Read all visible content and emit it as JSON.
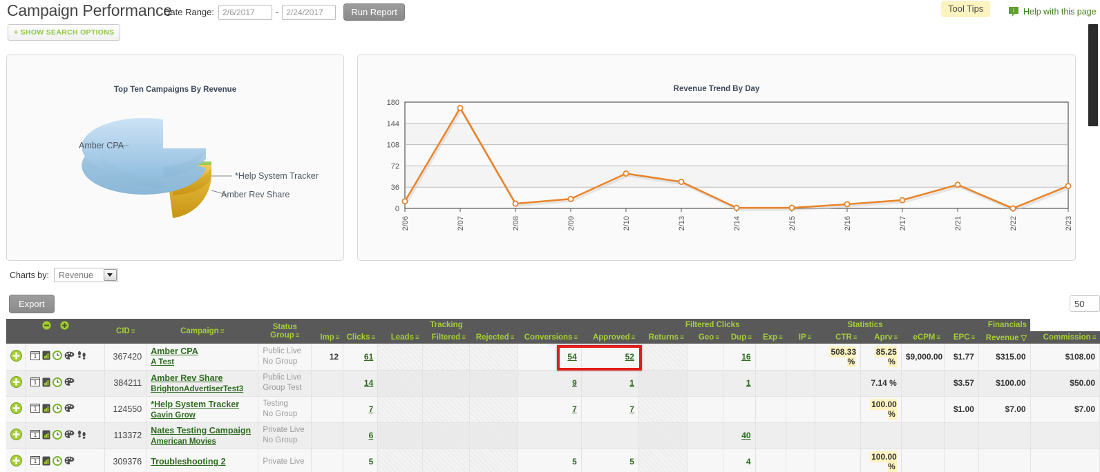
{
  "header": {
    "title": "Campaign Performance",
    "date_range_label": "Date Range:",
    "date_from": "2/6/2017",
    "date_to": "2/24/2017",
    "dash": "-",
    "run_report": "Run Report",
    "show_search_options": "+ SHOW SEARCH OPTIONS",
    "tool_tips": "Tool Tips",
    "help_text": "Help with this page"
  },
  "controls": {
    "charts_by_label": "Charts by:",
    "charts_by_value": "Revenue",
    "export_label": "Export",
    "rows_per_page": "50"
  },
  "colors": {
    "accent_green": "#a6ce39",
    "link_green": "#2d6a1e",
    "header_gray": "#595959",
    "line_orange": "#e8842a",
    "pie_blue": "#a8cbe8",
    "pie_gold": "#e8b93c",
    "highlight_yellow": "#fdf3c0",
    "redbox": "#e21b1b"
  },
  "chart_data": [
    {
      "type": "pie",
      "title": "Top Ten Campaigns By Revenue",
      "labels": [
        "Amber CPA",
        "*Help System Tracker",
        "Amber Rev Share"
      ],
      "values": [
        315.0,
        7.0,
        100.0
      ],
      "slice_colors": [
        "#a8cbe8",
        "#8dc63f",
        "#e8b93c"
      ],
      "legend": "callout-labels",
      "exploded": true
    },
    {
      "type": "line",
      "title": "Revenue Trend By Day",
      "xlabel": "",
      "ylabel": "",
      "categories": [
        "2/06",
        "2/07",
        "2/08",
        "2/09",
        "2/10",
        "2/13",
        "2/14",
        "2/15",
        "2/16",
        "2/17",
        "2/21",
        "2/22",
        "2/23"
      ],
      "values": [
        12,
        170,
        8,
        16,
        59,
        45,
        1,
        1,
        7,
        14,
        40,
        0,
        38
      ],
      "yticks": [
        0,
        36,
        72,
        108,
        144,
        180
      ],
      "ylim": [
        0,
        180
      ],
      "grid": true,
      "series_color": "#e8842a",
      "marker": "open-circle"
    }
  ],
  "table": {
    "group_headers": [
      {
        "label": "",
        "span": 5
      },
      {
        "label": "Tracking",
        "span": 6
      },
      {
        "label": "",
        "span": 1
      },
      {
        "label": "Filtered Clicks",
        "span": 4
      },
      {
        "label": "Statistics",
        "span": 4
      },
      {
        "label": "Financials",
        "span": 2
      }
    ],
    "columns": [
      {
        "label": "",
        "key": "expand"
      },
      {
        "label": "",
        "key": "icons"
      },
      {
        "label": "CID",
        "key": "cid",
        "sortable": true
      },
      {
        "label": "Campaign",
        "key": "campaign",
        "sortable": true
      },
      {
        "label": "Status Group",
        "key": "status_group",
        "sortable": true
      },
      {
        "label": "Imp",
        "key": "imp",
        "sortable": true
      },
      {
        "label": "Clicks",
        "key": "clicks",
        "sortable": true
      },
      {
        "label": "Leads",
        "key": "leads",
        "sortable": true
      },
      {
        "label": "Filtered",
        "key": "filtered",
        "sortable": true
      },
      {
        "label": "Rejected",
        "key": "rejected",
        "sortable": true
      },
      {
        "label": "Conversions",
        "key": "conversions",
        "sortable": true
      },
      {
        "label": "Approved",
        "key": "approved",
        "sortable": true
      },
      {
        "label": "Returns",
        "key": "returns",
        "sortable": true
      },
      {
        "label": "Geo",
        "key": "geo",
        "sortable": true
      },
      {
        "label": "Dup",
        "key": "dup",
        "sortable": true
      },
      {
        "label": "Exp",
        "key": "exp",
        "sortable": true
      },
      {
        "label": "IP",
        "key": "ip",
        "sortable": true
      },
      {
        "label": "CTR",
        "key": "ctr",
        "sortable": true
      },
      {
        "label": "Aprv",
        "key": "aprv",
        "sortable": true
      },
      {
        "label": "eCPM",
        "key": "ecpm",
        "sortable": true
      },
      {
        "label": "EPC",
        "key": "epc",
        "sortable": true
      },
      {
        "label": "Revenue",
        "key": "revenue",
        "sorted_desc": true
      },
      {
        "label": "Commission",
        "key": "commission",
        "sortable": true
      }
    ],
    "rows": [
      {
        "icons": [
          "calendar-icon",
          "mobile-chart-icon",
          "clock-icon",
          "palette-icon",
          "footsteps-icon"
        ],
        "cid": "367420",
        "campaign": "Amber CPA",
        "advertiser": "A Test",
        "status": "Public Live",
        "group": "No Group",
        "imp": "12",
        "clicks": "61",
        "leads": "",
        "filtered": "",
        "rejected": "",
        "conversions": "54",
        "approved": "52",
        "returns": "",
        "geo": "",
        "dup": "16",
        "exp": "",
        "ip": "",
        "ctr": "508.33 %",
        "ctr_hl": true,
        "aprv": "85.25 %",
        "aprv_hl": true,
        "ecpm": "$9,000.00",
        "epc": "$1.77",
        "revenue": "$315.00",
        "commission": "$108.00"
      },
      {
        "icons": [
          "calendar-icon",
          "mobile-chart-icon",
          "clock-icon",
          "palette-icon"
        ],
        "cid": "384211",
        "campaign": "Amber Rev Share",
        "advertiser": "BrightonAdvertiserTest3",
        "status": "Public Live",
        "group": "Group Test",
        "imp": "",
        "clicks": "14",
        "leads": "",
        "filtered": "",
        "rejected": "",
        "conversions": "9",
        "approved": "1",
        "returns": "",
        "geo": "",
        "dup": "1",
        "exp": "",
        "ip": "",
        "ctr": "",
        "ctr_hl": false,
        "aprv": "7.14 %",
        "aprv_hl": false,
        "ecpm": "",
        "epc": "$3.57",
        "revenue": "$100.00",
        "commission": "$50.00"
      },
      {
        "icons": [
          "calendar-icon",
          "mobile-chart-icon",
          "clock-icon",
          "palette-icon"
        ],
        "cid": "124550",
        "campaign": "*Help System Tracker",
        "advertiser": "Gavin Grow",
        "status": "Testing",
        "group": "No Group",
        "imp": "",
        "clicks": "7",
        "leads": "",
        "filtered": "",
        "rejected": "",
        "conversions": "7",
        "approved": "7",
        "returns": "",
        "geo": "",
        "dup": "",
        "exp": "",
        "ip": "",
        "ctr": "",
        "ctr_hl": false,
        "aprv": "100.00 %",
        "aprv_hl": true,
        "ecpm": "",
        "epc": "$1.00",
        "revenue": "$7.00",
        "commission": "$7.00"
      },
      {
        "icons": [
          "calendar-icon",
          "mobile-chart-icon",
          "clock-icon",
          "palette-icon",
          "footsteps-icon"
        ],
        "cid": "113372",
        "campaign": "Nates Testing Campaign",
        "advertiser": "American Movies",
        "status": "Private Live",
        "group": "No Group",
        "imp": "",
        "clicks": "6",
        "leads": "",
        "filtered": "",
        "rejected": "",
        "conversions": "",
        "approved": "",
        "returns": "",
        "geo": "",
        "dup": "40",
        "exp": "",
        "ip": "",
        "ctr": "",
        "ctr_hl": false,
        "aprv": "",
        "aprv_hl": false,
        "ecpm": "",
        "epc": "",
        "revenue": "",
        "commission": ""
      },
      {
        "icons": [
          "calendar-icon",
          "mobile-chart-icon",
          "clock-icon",
          "palette-icon"
        ],
        "cid": "309376",
        "campaign": "Troubleshooting 2",
        "advertiser": "",
        "status": "Private Live",
        "group": "",
        "imp": "",
        "clicks": "5",
        "leads": "",
        "filtered": "",
        "rejected": "",
        "conversions": "5",
        "approved": "5",
        "returns": "",
        "geo": "",
        "dup": "4",
        "exp": "",
        "ip": "",
        "ctr": "",
        "ctr_hl": false,
        "aprv": "100.00 %",
        "aprv_hl": true,
        "ecpm": "",
        "epc": "",
        "revenue": "",
        "commission": ""
      }
    ]
  }
}
